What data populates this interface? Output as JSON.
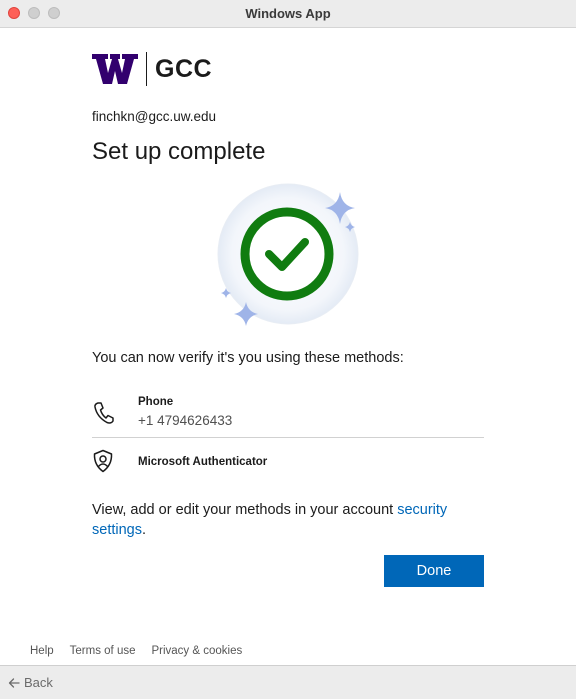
{
  "window": {
    "title": "Windows App"
  },
  "brand": {
    "logo_icon": "uw-w-logo",
    "org_name": "GCC",
    "logo_color": "#32006e"
  },
  "account": {
    "email": "finchkn@gcc.uw.edu"
  },
  "page": {
    "heading": "Set up complete",
    "hero_icon": "checkmark-circle-icon",
    "verify_text": "You can now verify it's you using these methods:",
    "account_text": "View, add or edit your methods in your account ",
    "security_link": "security settings",
    "period": ".",
    "accent_color": "#0067b8",
    "success_color": "#107c10"
  },
  "methods": [
    {
      "icon": "phone-icon",
      "name": "Phone",
      "detail": "+1 4794626433"
    },
    {
      "icon": "authenticator-icon",
      "name": "Microsoft Authenticator"
    }
  ],
  "actions": {
    "done_label": "Done"
  },
  "footer": {
    "links": [
      "Help",
      "Terms of use",
      "Privacy & cookies"
    ]
  },
  "nav": {
    "back_label": "Back"
  }
}
